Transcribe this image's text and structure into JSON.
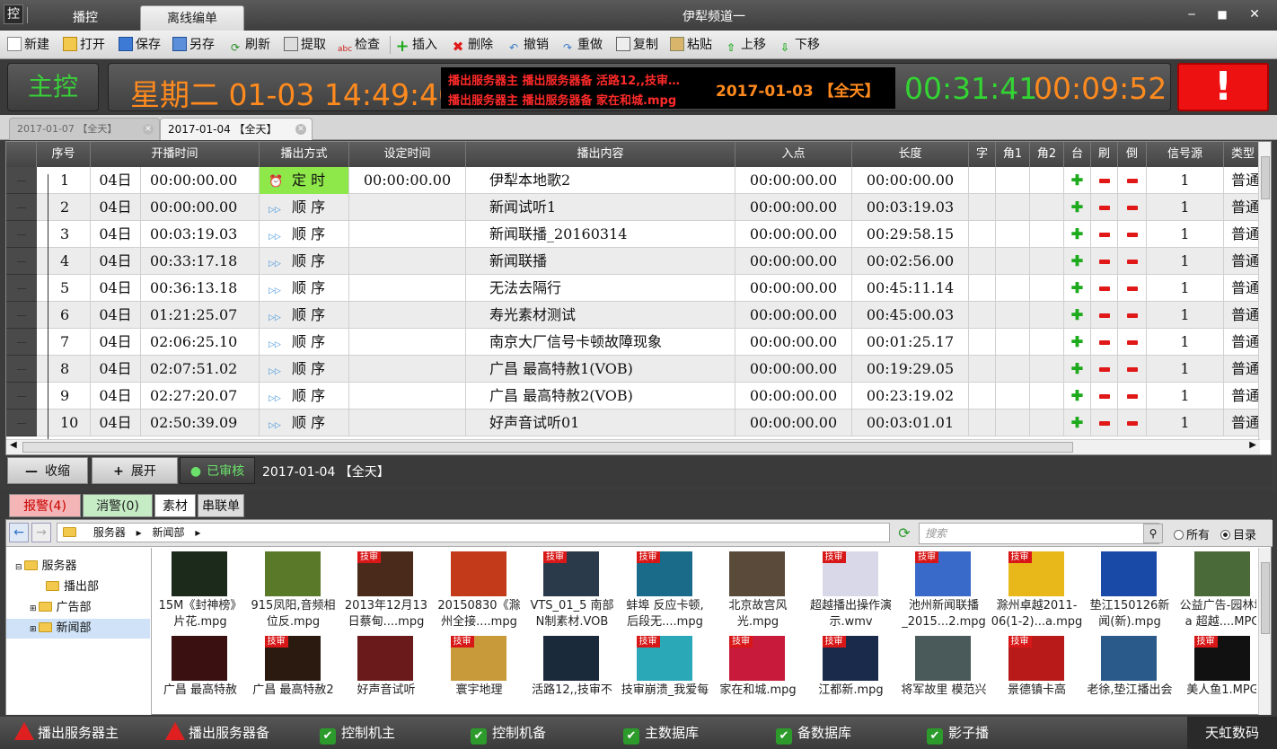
{
  "app": {
    "icon_char": "控",
    "title": "伊犁频道一"
  },
  "top_tabs": [
    {
      "label": "播控"
    },
    {
      "label": "离线编单"
    }
  ],
  "toolbar": [
    {
      "label": "新建",
      "icon": "new-file-icon"
    },
    {
      "label": "打开",
      "icon": "open-folder-icon"
    },
    {
      "label": "保存",
      "icon": "save-icon"
    },
    {
      "label": "另存",
      "icon": "save-as-icon"
    },
    {
      "label": "刷新",
      "icon": "refresh-icon"
    },
    {
      "label": "提取",
      "icon": "extract-icon"
    },
    {
      "label": "检查",
      "icon": "spellcheck-icon"
    },
    {
      "label": "插入",
      "icon": "insert-plus-icon"
    },
    {
      "label": "删除",
      "icon": "delete-x-icon"
    },
    {
      "label": "撤销",
      "icon": "undo-icon"
    },
    {
      "label": "重做",
      "icon": "redo-icon"
    },
    {
      "label": "复制",
      "icon": "copy-icon"
    },
    {
      "label": "粘贴",
      "icon": "paste-icon"
    },
    {
      "label": "上移",
      "icon": "arrow-up-icon"
    },
    {
      "label": "下移",
      "icon": "arrow-down-icon"
    }
  ],
  "status": {
    "master_label": "主控",
    "clock": "星期二 01-03 14:49:40",
    "led_line1": "播出服务器主  播出服务器备  活路12,,技审…",
    "led_line2": "播出服务器主  播出服务器备  家在和城.mpg",
    "led_date": "2017-01-03 【全天】",
    "timer_elapsed": "00:31:41",
    "timer_remaining": "00:09:52",
    "alert_symbol": "!"
  },
  "doc_tabs": [
    {
      "label": "2017-01-07 【全天】"
    },
    {
      "label": "2017-01-04 【全天】"
    }
  ],
  "grid": {
    "columns": [
      "序号",
      "开播时间",
      "播出方式",
      "设定时间",
      "播出内容",
      "入点",
      "长度",
      "字",
      "角1",
      "角2",
      "台",
      "刷",
      "倒",
      "信号源",
      "类型"
    ],
    "rows": [
      {
        "no": "1",
        "day": "04日",
        "start": "00:00:00.00",
        "mode": "定 时",
        "set": "00:00:00.00",
        "content": "伊犁本地歌2",
        "in": "00:00:00.00",
        "len": "00:00:00.00",
        "src": "1",
        "type": "普通"
      },
      {
        "no": "2",
        "day": "04日",
        "start": "00:00:00.00",
        "mode": "顺 序",
        "set": "",
        "content": "新闻试听1",
        "in": "00:00:00.00",
        "len": "00:03:19.03",
        "src": "1",
        "type": "普通"
      },
      {
        "no": "3",
        "day": "04日",
        "start": "00:03:19.03",
        "mode": "顺 序",
        "set": "",
        "content": "新闻联播_20160314",
        "in": "00:00:00.00",
        "len": "00:29:58.15",
        "src": "1",
        "type": "普通"
      },
      {
        "no": "4",
        "day": "04日",
        "start": "00:33:17.18",
        "mode": "顺 序",
        "set": "",
        "content": "新闻联播",
        "in": "00:00:00.00",
        "len": "00:02:56.00",
        "src": "1",
        "type": "普通"
      },
      {
        "no": "5",
        "day": "04日",
        "start": "00:36:13.18",
        "mode": "顺 序",
        "set": "",
        "content": "无法去隔行",
        "in": "00:00:00.00",
        "len": "00:45:11.14",
        "src": "1",
        "type": "普通"
      },
      {
        "no": "6",
        "day": "04日",
        "start": "01:21:25.07",
        "mode": "顺 序",
        "set": "",
        "content": "寿光素材测试",
        "in": "00:00:00.00",
        "len": "00:45:00.03",
        "src": "1",
        "type": "普通"
      },
      {
        "no": "7",
        "day": "04日",
        "start": "02:06:25.10",
        "mode": "顺 序",
        "set": "",
        "content": "南京大厂信号卡顿故障现象",
        "in": "00:00:00.00",
        "len": "00:01:25.17",
        "src": "1",
        "type": "普通"
      },
      {
        "no": "8",
        "day": "04日",
        "start": "02:07:51.02",
        "mode": "顺 序",
        "set": "",
        "content": "广昌 最高特赦1(VOB)",
        "in": "00:00:00.00",
        "len": "00:19:29.05",
        "src": "1",
        "type": "普通"
      },
      {
        "no": "9",
        "day": "04日",
        "start": "02:27:20.07",
        "mode": "顺 序",
        "set": "",
        "content": "广昌 最高特赦2(VOB)",
        "in": "00:00:00.00",
        "len": "00:23:19.02",
        "src": "1",
        "type": "普通"
      },
      {
        "no": "10",
        "day": "04日",
        "start": "02:50:39.09",
        "mode": "顺 序",
        "set": "",
        "content": "好声音试听01",
        "in": "00:00:00.00",
        "len": "00:03:01.01",
        "src": "1",
        "type": "普通"
      }
    ]
  },
  "actions": {
    "collapse": "收缩",
    "expand": "展开",
    "audited": "已审核",
    "date": "2017-01-04 【全天】"
  },
  "bottom_tabs": [
    {
      "label": "报警(4)"
    },
    {
      "label": "消警(0)"
    },
    {
      "label": "素材"
    },
    {
      "label": "串联单"
    }
  ],
  "browser": {
    "path": [
      "服务器",
      "新闻部"
    ],
    "search_placeholder": "搜索",
    "radio_all": "所有",
    "radio_dir": "目录",
    "tree": [
      "服务器",
      "播出部",
      "广告部",
      "新闻部"
    ],
    "thumbs_row1": [
      {
        "l1": "15M《封神榜》",
        "l2": "片花.mpg",
        "badge": ""
      },
      {
        "l1": "915凤阳,音频相",
        "l2": "位反.mpg",
        "badge": ""
      },
      {
        "l1": "2013年12月13",
        "l2": "日蔡甸....mpg",
        "badge": "技审"
      },
      {
        "l1": "20150830《滁",
        "l2": "州全接....mpg",
        "badge": ""
      },
      {
        "l1": "VTS_01_5 南部",
        "l2": "N制素材.VOB",
        "badge": "技审"
      },
      {
        "l1": "蚌埠 反应卡顿,",
        "l2": "后段无....mpg",
        "badge": "技审"
      },
      {
        "l1": "北京故宫风",
        "l2": "光.mpg",
        "badge": ""
      },
      {
        "l1": "超越播出操作演",
        "l2": "示.wmv",
        "badge": "技审"
      },
      {
        "l1": "池州新闻联播",
        "l2": "_2015...2.mpg",
        "badge": "技审"
      },
      {
        "l1": "滁州卓越2011-",
        "l2": "06(1-2)...a.mpg",
        "badge": "技审"
      },
      {
        "l1": "垫江150126新",
        "l2": "闻(新).mpg",
        "badge": ""
      },
      {
        "l1": "公益广告-园林城",
        "l2": "a 超越....MPG",
        "badge": ""
      }
    ],
    "thumbs_row2": [
      {
        "l1": "广昌 最高特赦",
        "badge": ""
      },
      {
        "l1": "广昌 最高特赦2",
        "badge": "技审"
      },
      {
        "l1": "好声音试听",
        "badge": ""
      },
      {
        "l1": "寰宇地理",
        "badge": "技审"
      },
      {
        "l1": "活路12,,技审不",
        "badge": ""
      },
      {
        "l1": "技审崩溃_我爱每",
        "badge": "技审"
      },
      {
        "l1": "家在和城.mpg",
        "badge": "技审"
      },
      {
        "l1": "江都新.mpg",
        "badge": "技审"
      },
      {
        "l1": "将军故里 模范兴",
        "badge": ""
      },
      {
        "l1": "景德镇卡高",
        "badge": "技审"
      },
      {
        "l1": "老徐,垫江播出会",
        "badge": ""
      },
      {
        "l1": "美人鱼1.MPG",
        "badge": "技审"
      }
    ]
  },
  "statusbar": {
    "items": [
      {
        "label": "播出服务器主",
        "state": "warn"
      },
      {
        "label": "播出服务器备",
        "state": "warn"
      },
      {
        "label": "控制机主",
        "state": "ok"
      },
      {
        "label": "控制机备",
        "state": "ok"
      },
      {
        "label": "主数据库",
        "state": "ok"
      },
      {
        "label": "备数据库",
        "state": "ok"
      },
      {
        "label": "影子播",
        "state": "ok"
      }
    ],
    "brand": "天虹数码"
  },
  "colors": {
    "accent_orange": "#ff8a1e",
    "status_green": "#33d433",
    "alert_red": "#ee1111",
    "timer_mode_green": "#8fe84a"
  }
}
